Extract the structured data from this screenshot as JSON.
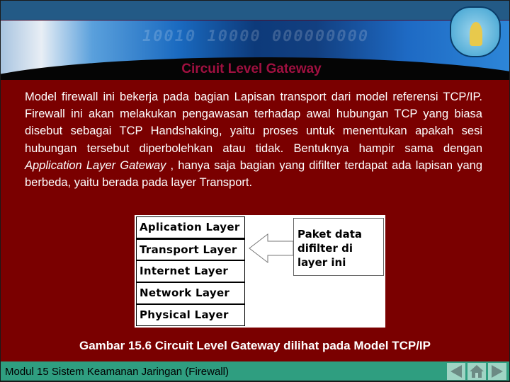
{
  "slide": {
    "title": "Circuit Level Gateway",
    "banner_binary": "10010  10000 000000000",
    "body_before": "Model firewall ini bekerja pada bagian Lapisan transport dari model referensi TCP/IP. Firewall ini akan melakukan pengawasan terhadap awal hubungan TCP yang biasa disebut sebagai TCP Handshaking, yaitu proses untuk menentukan apakah sesi hubungan tersebut diperbolehkan atau tidak. Bentuknya hampir sama dengan ",
    "body_italic": "Application Layer Gateway",
    "body_after": " , hanya saja bagian yang difilter terdapat ada lapisan yang berbeda, yaitu berada pada layer Transport.",
    "diagram": {
      "layers": [
        "Aplication Layer",
        "Transport Layer",
        "Internet  Layer",
        "Network  Layer",
        "Physical Layer"
      ],
      "note": [
        "Paket data",
        "difilter di",
        "layer ini"
      ]
    },
    "caption": "Gambar 15.6 Circuit Level Gateway dilihat pada Model TCP/IP"
  },
  "footer": {
    "text": "Modul 15 Sistem Keamanan Jaringan (Firewall)",
    "nav": [
      "previous-icon",
      "home-icon",
      "next-icon"
    ]
  },
  "colors": {
    "background": "#7a0000",
    "title": "#a01040",
    "footer": "#2f9e80",
    "topbar": "#235a86"
  }
}
